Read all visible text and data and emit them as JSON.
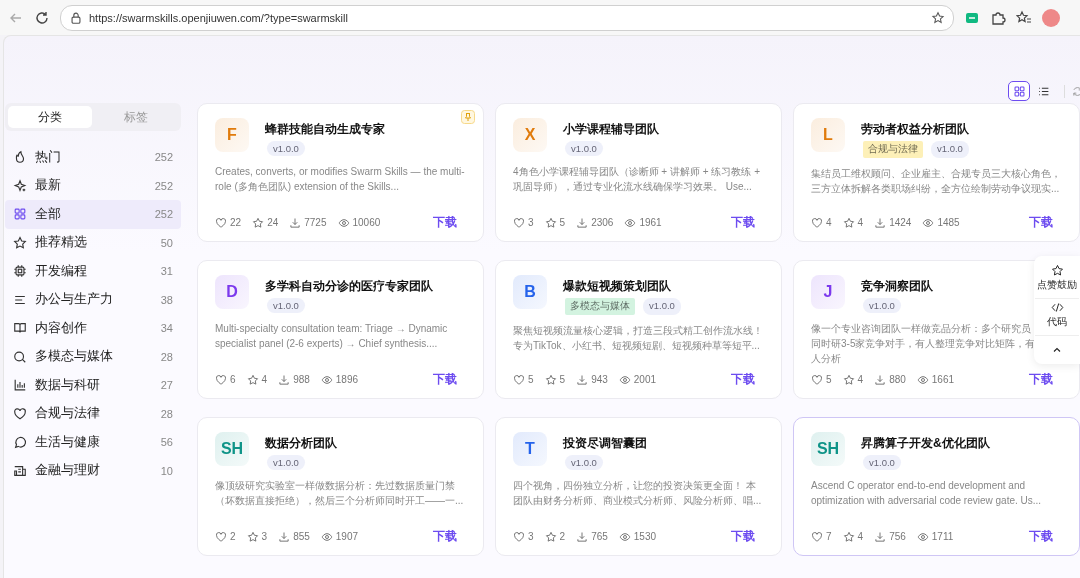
{
  "browser": {
    "url": "https://swarmskills.openjiuwen.com/?type=swarmskill"
  },
  "view_toggle": [
    {
      "selected": true
    },
    {
      "selected": false
    }
  ],
  "sidebar": {
    "tabs": [
      {
        "label": "分类",
        "selected": true
      },
      {
        "label": "标签",
        "selected": false
      }
    ],
    "items": [
      {
        "label": "热门",
        "count": "252",
        "selected": false
      },
      {
        "label": "最新",
        "count": "252",
        "selected": false
      },
      {
        "label": "全部",
        "count": "252",
        "selected": true
      },
      {
        "label": "推荐精选",
        "count": "50",
        "selected": false
      },
      {
        "label": "开发编程",
        "count": "31",
        "selected": false
      },
      {
        "label": "办公与生产力",
        "count": "38",
        "selected": false
      },
      {
        "label": "内容创作",
        "count": "34",
        "selected": false
      },
      {
        "label": "多模态与媒体",
        "count": "28",
        "selected": false
      },
      {
        "label": "数据与科研",
        "count": "27",
        "selected": false
      },
      {
        "label": "合规与法律",
        "count": "28",
        "selected": false
      },
      {
        "label": "生活与健康",
        "count": "56",
        "selected": false
      },
      {
        "label": "金融与理财",
        "count": "10",
        "selected": false
      }
    ]
  },
  "cards": [
    {
      "letter": "F",
      "color": "#e07b0c",
      "title": "蜂群技能自动生成专家",
      "version": "v1.0.0",
      "pinned": true,
      "highlighted": false,
      "description": "Creates, converts, or modifies Swarm Skills — the multi-role (多角色团队) extension of the Skills...",
      "likes": "22",
      "stars": "24",
      "downloads": "7725",
      "views": "10060",
      "action": "下载"
    },
    {
      "letter": "X",
      "color": "#e07b0c",
      "title": "小学课程辅导团队",
      "version": "v1.0.0",
      "pinned": false,
      "highlighted": false,
      "description": "4角色小学课程辅导团队（诊断师 + 讲解师 + 练习教练 + 巩固导师），通过专业化流水线确保学习效果。 Use...",
      "likes": "3",
      "stars": "5",
      "downloads": "2306",
      "views": "1961",
      "action": "下载"
    },
    {
      "letter": "L",
      "color": "#e07b0c",
      "title": "劳动者权益分析团队",
      "tag": {
        "label": "合规与法律",
        "color": "#fdf0b8"
      },
      "version": "v1.0.0",
      "pinned": false,
      "highlighted": false,
      "description": "集结员工维权顾问、企业雇主、合规专员三大核心角色，三方立体拆解各类职场纠纷，全方位绘制劳动争议现实...",
      "likes": "4",
      "stars": "4",
      "downloads": "1424",
      "views": "1485",
      "action": "下载"
    },
    {
      "letter": "D",
      "color": "#7c3aed",
      "title": "多学科自动分诊的医疗专家团队",
      "version": "v1.0.0",
      "pinned": false,
      "highlighted": false,
      "description": "Multi-specialty consultation team: Triage → Dynamic specialist panel (2-6 experts) → Chief synthesis....",
      "likes": "6",
      "stars": "4",
      "downloads": "988",
      "views": "1896",
      "action": "下载"
    },
    {
      "letter": "B",
      "color": "#2563eb",
      "title": "爆款短视频策划团队",
      "tag": {
        "label": "多模态与媒体",
        "color": "#d3f3e0"
      },
      "version": "v1.0.0",
      "pinned": false,
      "highlighted": false,
      "description": "聚焦短视频流量核心逻辑，打造三段式精工创作流水线！专为TikTok、小红书、短视频短剧、短视频种草等短平...",
      "likes": "5",
      "stars": "5",
      "downloads": "943",
      "views": "2001",
      "action": "下载"
    },
    {
      "letter": "J",
      "color": "#7c3aed",
      "title": "竞争洞察团队",
      "version": "v1.0.0",
      "pinned": false,
      "highlighted": false,
      "description": "像一个专业咨询团队一样做竞品分析：多个研究员同时研3-5家竞争对手，有人整理竞争对比矩阵，有人分析",
      "likes": "5",
      "stars": "4",
      "downloads": "880",
      "views": "1661",
      "action": "下载"
    },
    {
      "letter": "SH",
      "color": "#0f9488",
      "title": "数据分析团队",
      "version": "v1.0.0",
      "pinned": false,
      "highlighted": false,
      "description": "像顶级研究实验室一样做数据分析：先过数据质量门禁（坏数据直接拒绝），然后三个分析师同时开工——一...",
      "likes": "2",
      "stars": "3",
      "downloads": "855",
      "views": "1907",
      "action": "下载"
    },
    {
      "letter": "T",
      "color": "#2563eb",
      "title": "投资尽调智囊团",
      "version": "v1.0.0",
      "pinned": false,
      "highlighted": false,
      "description": "四个视角，四份独立分析，让您的投资决策更全面！ 本团队由财务分析师、商业模式分析师、风险分析师、唱...",
      "likes": "3",
      "stars": "2",
      "downloads": "765",
      "views": "1530",
      "action": "下载"
    },
    {
      "letter": "SH",
      "color": "#0f9488",
      "title": "昇腾算子开发&优化团队",
      "version": "v1.0.0",
      "pinned": false,
      "highlighted": true,
      "description": "Ascend C operator end-to-end development and optimization with adversarial code review gate. Us...",
      "likes": "7",
      "stars": "4",
      "downloads": "756",
      "views": "1711",
      "action": "下载"
    }
  ],
  "float_panel": {
    "items": [
      {
        "label": "点赞鼓励"
      },
      {
        "label": "代码"
      }
    ]
  }
}
